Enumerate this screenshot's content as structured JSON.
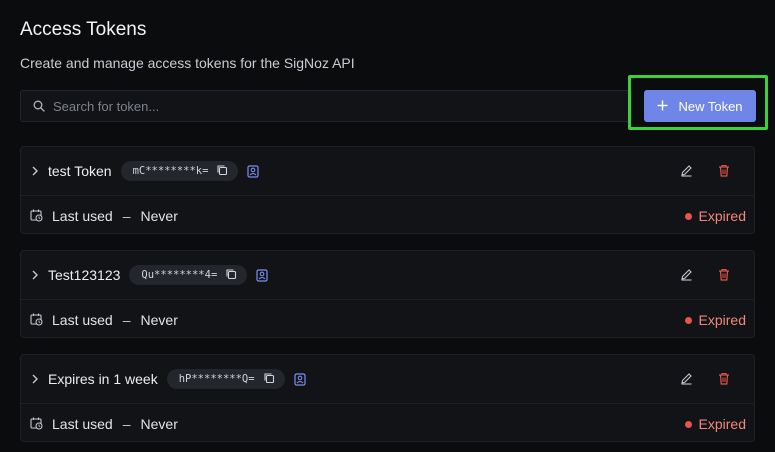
{
  "header": {
    "title": "Access Tokens",
    "subtitle": "Create and manage access tokens for the SigNoz API"
  },
  "search": {
    "placeholder": "Search for token...",
    "value": ""
  },
  "new_token_button": {
    "label": "New Token"
  },
  "colors": {
    "accent": "#6f86e8",
    "highlight": "#3ad13a",
    "expired": "#e5564a"
  },
  "tokens": [
    {
      "name": "test Token",
      "masked": "mC********k=",
      "last_used_label": "Last used",
      "separator": "–",
      "last_used": "Never",
      "status": "Expired"
    },
    {
      "name": "Test123123",
      "masked": "Qu********4=",
      "last_used_label": "Last used",
      "separator": "–",
      "last_used": "Never",
      "status": "Expired"
    },
    {
      "name": "Expires in 1 week",
      "masked": "hP********Q=",
      "last_used_label": "Last used",
      "separator": "–",
      "last_used": "Never",
      "status": "Expired"
    }
  ]
}
